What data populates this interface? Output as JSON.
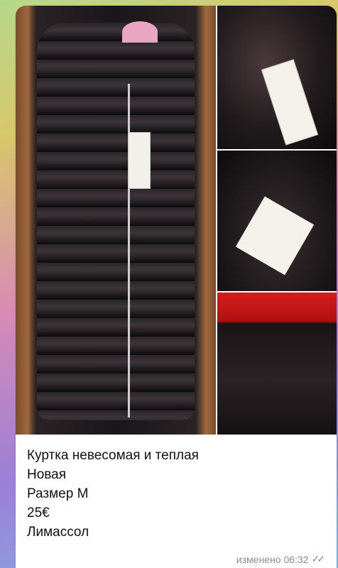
{
  "message": {
    "lines": [
      "Куртка невесомая и теплая",
      "Новая",
      "Размер М",
      "25€",
      "Лимассол"
    ],
    "edited_label": "изменено",
    "time": "06:32",
    "status_icon": "double-check-icon"
  },
  "media": {
    "photo_count": 4
  },
  "colors": {
    "bubble": "#ffffff",
    "meta_text": "#8c8c8c"
  }
}
